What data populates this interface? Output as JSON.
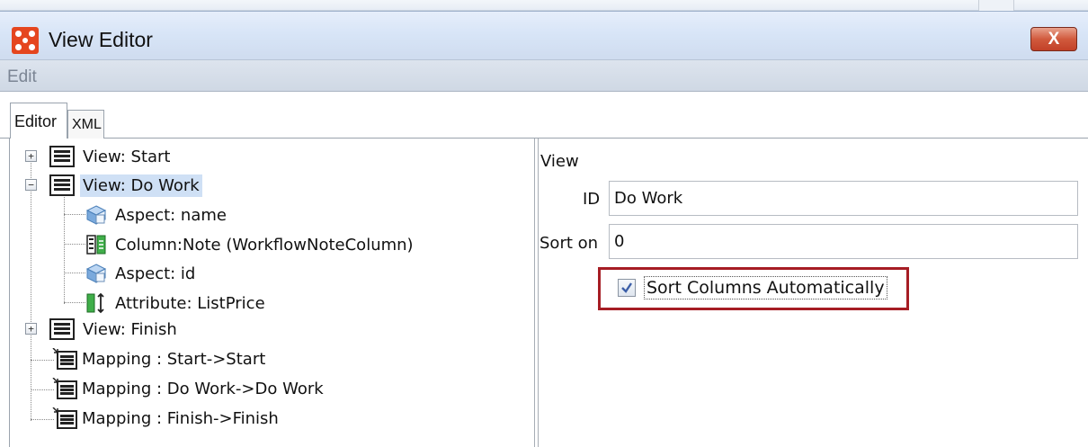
{
  "window": {
    "title": "View Editor",
    "close_label": "X"
  },
  "menu": {
    "edit_label": "Edit"
  },
  "tabs": [
    {
      "label": "Editor",
      "active": true
    },
    {
      "label": "XML",
      "active": false
    }
  ],
  "tree": {
    "items": [
      {
        "label": "View: Start",
        "icon": "view-icon",
        "expander": "+",
        "selected": false
      },
      {
        "label": "View: Do Work",
        "icon": "view-icon",
        "expander": "−",
        "selected": true
      },
      {
        "label": "Aspect: name",
        "icon": "aspect-icon"
      },
      {
        "label": "Column:Note (WorkflowNoteColumn)",
        "icon": "column-icon"
      },
      {
        "label": "Aspect: id",
        "icon": "aspect-icon"
      },
      {
        "label": "Attribute: ListPrice",
        "icon": "attribute-icon"
      },
      {
        "label": "View: Finish",
        "icon": "view-icon",
        "expander": "+",
        "selected": false
      },
      {
        "label": "Mapping : Start->Start",
        "icon": "mapping-icon"
      },
      {
        "label": "Mapping : Do Work->Do Work",
        "icon": "mapping-icon"
      },
      {
        "label": "Mapping : Finish->Finish",
        "icon": "mapping-icon"
      }
    ]
  },
  "properties": {
    "section_title": "View",
    "id_label": "ID",
    "id_value": "Do Work",
    "sort_on_label": "Sort on",
    "sort_on_value": "0",
    "sort_columns_label": "Sort Columns Automatically",
    "sort_columns_checked": true
  },
  "colors": {
    "highlight_box": "#a61d24",
    "selection": "#cfe0f5",
    "close_button": "#c24128",
    "app_icon": "#e5461f"
  }
}
